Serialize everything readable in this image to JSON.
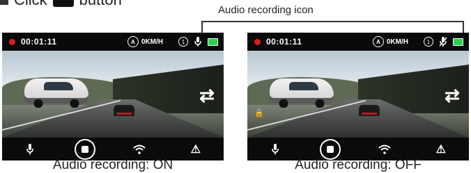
{
  "instruction": {
    "before": "Click",
    "after": "button"
  },
  "callout": {
    "text": "Audio recording icon"
  },
  "screens": [
    {
      "status": {
        "time": "00:01:11",
        "speed": "0KM/H"
      },
      "caption": "Audio recording: ON"
    },
    {
      "status": {
        "time": "00:01:11",
        "speed": "0KM/H"
      },
      "caption": "Audio recording: OFF"
    }
  ],
  "colors": {
    "record": "#e01b1b",
    "battery": "#2ad14b"
  }
}
